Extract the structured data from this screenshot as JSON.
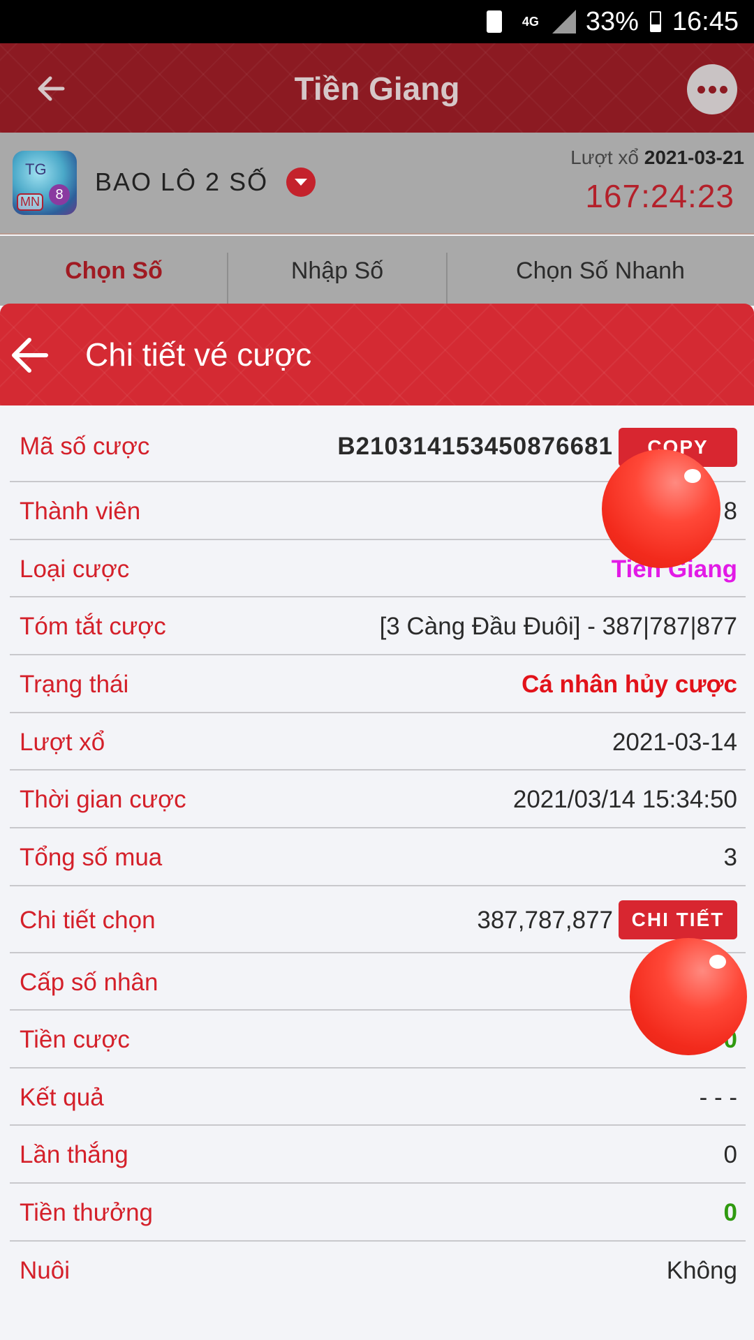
{
  "status_bar": {
    "network": "4G",
    "battery": "33%",
    "time": "16:45"
  },
  "header": {
    "title": "Tiền Giang",
    "back_icon": "arrow-left-icon",
    "menu_icon": "more-dots-icon"
  },
  "game": {
    "logo_text_top": "TG",
    "logo_text_bottom": "MN",
    "logo_ball": "8",
    "name": "BAO LÔ 2 SỐ",
    "draw_label": "Lượt xổ",
    "draw_date": "2021-03-21",
    "countdown": "167:24:23"
  },
  "tabs": [
    {
      "label": "Chọn Số",
      "active": true
    },
    {
      "label": "Nhập Số",
      "active": false
    },
    {
      "label": "Chọn Số Nhanh",
      "active": false
    }
  ],
  "panel": {
    "title": "Chi tiết vé cược",
    "copy_label": "COPY",
    "detail_label": "CHI TIẾT"
  },
  "details": [
    {
      "label": "Mã số cược",
      "value": "B210314153450876681"
    },
    {
      "label": "Thành viên",
      "value": "k 8"
    },
    {
      "label": "Loại cược",
      "value": "Tiền Giang"
    },
    {
      "label": "Tóm tắt cược",
      "value": "[3 Càng Đầu Đuôi] - 387|787|877"
    },
    {
      "label": "Trạng thái",
      "value": "Cá nhân hủy cược"
    },
    {
      "label": "Lượt xổ",
      "value": "2021-03-14"
    },
    {
      "label": "Thời gian cược",
      "value": "2021/03/14 15:34:50"
    },
    {
      "label": "Tổng số mua",
      "value": "3"
    },
    {
      "label": "Chi tiết chọn",
      "value": "387,787,877"
    },
    {
      "label": "Cấp số nhân",
      "value": ""
    },
    {
      "label": "Tiền cược",
      "value": "0"
    },
    {
      "label": "Kết quả",
      "value": "- - -"
    },
    {
      "label": "Lần thắng",
      "value": "0"
    },
    {
      "label": "Tiền thưởng",
      "value": "0"
    },
    {
      "label": "Nuôi",
      "value": "Không"
    }
  ],
  "colors": {
    "header_red": "#8c1a22",
    "panel_red": "#d42a33",
    "label_red": "#d4202a",
    "magenta": "#e21ae6",
    "green": "#2f9a10"
  }
}
